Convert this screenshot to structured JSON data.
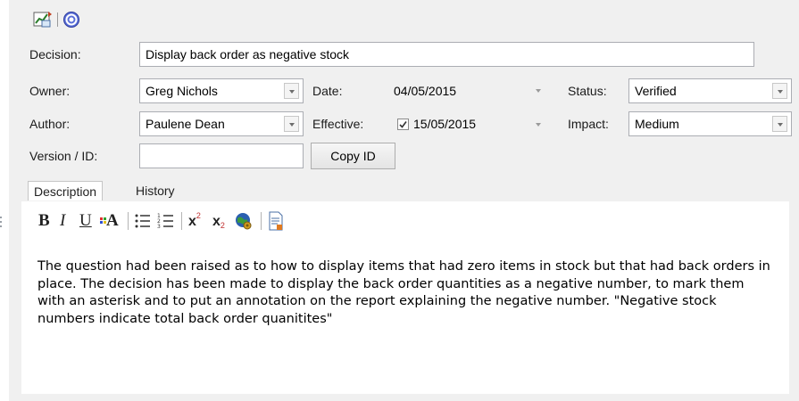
{
  "toolbar": {
    "icons": [
      "chart-properties-icon",
      "help-icon"
    ]
  },
  "form": {
    "decision_label": "Decision:",
    "decision_value": "Display back order as negative stock",
    "owner_label": "Owner:",
    "owner_value": "Greg Nichols",
    "date_label": "Date:",
    "date_value": "04/05/2015",
    "status_label": "Status:",
    "status_value": "Verified",
    "author_label": "Author:",
    "author_value": "Paulene Dean",
    "effective_label": "Effective:",
    "effective_checked": true,
    "effective_value": "15/05/2015",
    "impact_label": "Impact:",
    "impact_value": "Medium",
    "version_label": "Version / ID:",
    "version_value": "",
    "copy_id_label": "Copy ID"
  },
  "tabs": [
    {
      "label": "Description",
      "active": true
    },
    {
      "label": "History",
      "active": false
    }
  ],
  "editor_toolbar": {
    "bold": "B",
    "italic": "I",
    "underline": "U",
    "font_color": "A",
    "superscript": "x",
    "superscript_mark": "2",
    "subscript": "x",
    "subscript_mark": "2"
  },
  "description_text": "The question had been raised as to how to display items that had zero items in stock but that had back orders in place. The decision has been made to display the back order quantities as a negative number, to mark them with an asterisk and to put an annotation on the report explaining the negative number. \"Negative stock numbers indicate total back order quanitites\"",
  "colors": {
    "panel_bg": "#f0f0f0",
    "field_border": "#abadb3",
    "accent_blue": "#1e5bb8"
  }
}
